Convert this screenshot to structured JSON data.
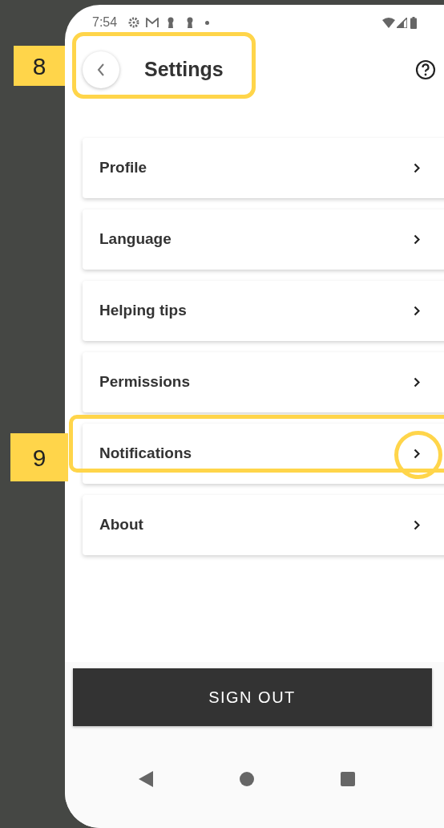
{
  "status_bar": {
    "time": "7:54"
  },
  "header": {
    "title": "Settings"
  },
  "menu_items": [
    {
      "label": "Profile"
    },
    {
      "label": "Language"
    },
    {
      "label": "Helping tips"
    },
    {
      "label": "Permissions"
    },
    {
      "label": "Notifications"
    },
    {
      "label": "About"
    }
  ],
  "sign_out_button": {
    "label": "SIGN OUT"
  },
  "annotations": [
    {
      "label": "8"
    },
    {
      "label": "9"
    }
  ]
}
